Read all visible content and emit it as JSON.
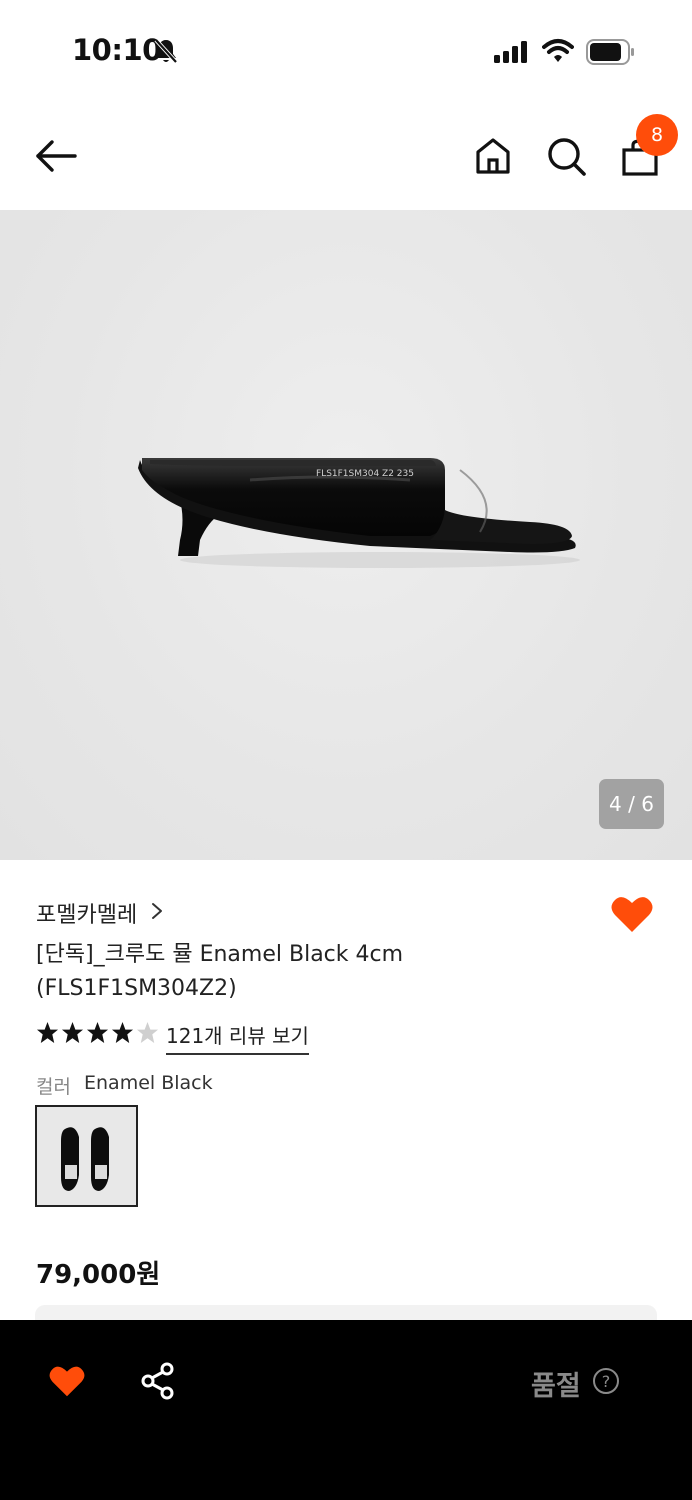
{
  "status_bar": {
    "time": "10:10",
    "icons": [
      "bell-slash-icon",
      "signal-icon",
      "wifi-icon",
      "battery-icon"
    ]
  },
  "nav": {
    "icons": [
      "back-arrow-icon",
      "home-icon",
      "search-icon",
      "shopping-bag-icon"
    ],
    "cart_count": "8"
  },
  "gallery": {
    "page_indicator": "4 / 6",
    "product_label": "FLS1F1SM304 Z2 235"
  },
  "product": {
    "brand": "포멜카멜레",
    "title": "[단독]_크루도 뮬 Enamel Black 4cm (FLS1F1SM304Z2)",
    "rating": 4,
    "rating_max": 5,
    "review_link": "121개 리뷰 보기",
    "color_label": "컬러",
    "color_value": "Enamel Black",
    "price": "79,000원"
  },
  "bottom_bar": {
    "sold_out": "품절",
    "icons": [
      "heart-icon",
      "share-icon",
      "help-circle-icon"
    ]
  },
  "colors": {
    "accent": "#ff4d0a",
    "bottom_bar_bg": "#000000"
  }
}
